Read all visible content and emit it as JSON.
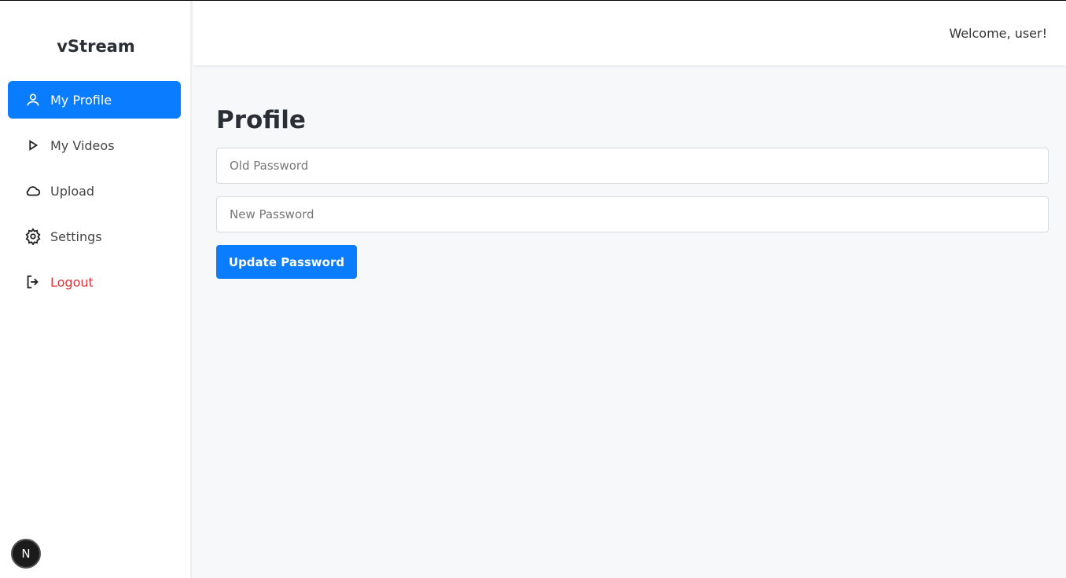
{
  "app": {
    "brand": "vStream"
  },
  "sidebar": {
    "items": [
      {
        "label": "My Profile",
        "icon": "user-icon",
        "active": true
      },
      {
        "label": "My Videos",
        "icon": "play-icon"
      },
      {
        "label": "Upload",
        "icon": "cloud-icon"
      },
      {
        "label": "Settings",
        "icon": "gear-icon"
      },
      {
        "label": "Logout",
        "icon": "logout-icon"
      }
    ],
    "badge": "N"
  },
  "header": {
    "welcome": "Welcome, user!"
  },
  "main": {
    "title": "Profile",
    "old_password_placeholder": "Old Password",
    "new_password_placeholder": "New Password",
    "update_button": "Update Password"
  },
  "colors": {
    "accent": "#0a7cff",
    "danger": "#e0353f"
  }
}
